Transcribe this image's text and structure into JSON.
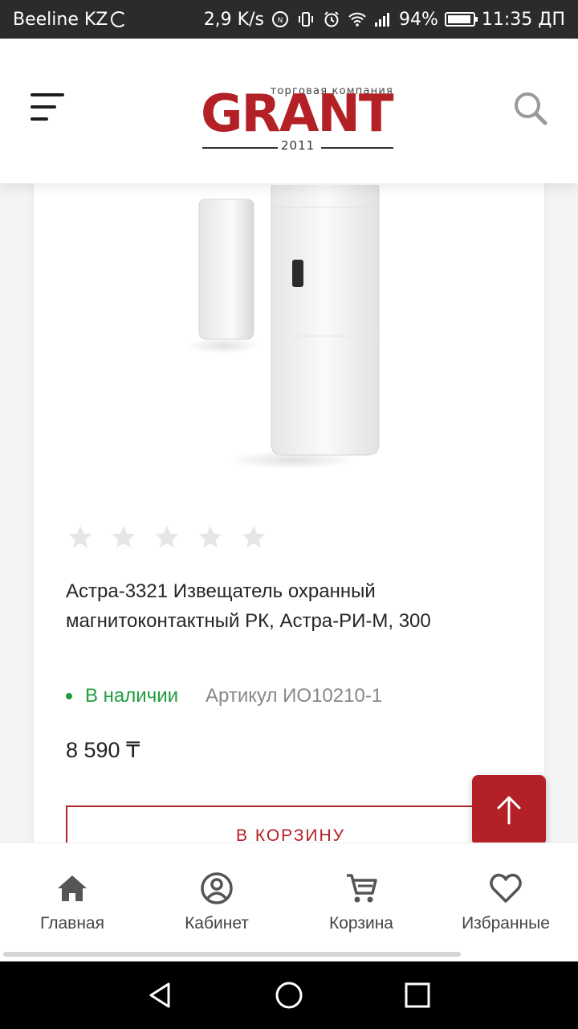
{
  "status_bar": {
    "carrier": "Beeline KZ",
    "speed": "2,9 K/s",
    "battery_percent": "94%",
    "battery_level": 0.94,
    "time": "11:35 ДП"
  },
  "header": {
    "logo_tagline": "торговая компания",
    "logo_word": "GRANT",
    "logo_year": "2011",
    "menu_icon": "menu-icon",
    "search_icon": "search-icon"
  },
  "product": {
    "image_icon": "door-magnetic-sensor-image",
    "rating": 0,
    "rating_max": 5,
    "title": "Астра-3321 Извещатель охранный магнитоконтактный РК, Астра-РИ-М, 300",
    "availability": "В наличии",
    "sku": "Артикул ИО10210-1",
    "price": "8 590 ₸",
    "cart_button": "В КОРЗИНУ"
  },
  "colors": {
    "brand": "#b32025",
    "in_stock": "#1f9e3e"
  },
  "bottom_nav": {
    "items": [
      {
        "label": "Главная",
        "icon": "home-icon"
      },
      {
        "label": "Кабинет",
        "icon": "account-icon"
      },
      {
        "label": "Корзина",
        "icon": "cart-icon"
      },
      {
        "label": "Избранные",
        "icon": "heart-icon"
      }
    ]
  },
  "scrollbar": {
    "position_fraction": 0.0,
    "visible_fraction": 0.8
  }
}
